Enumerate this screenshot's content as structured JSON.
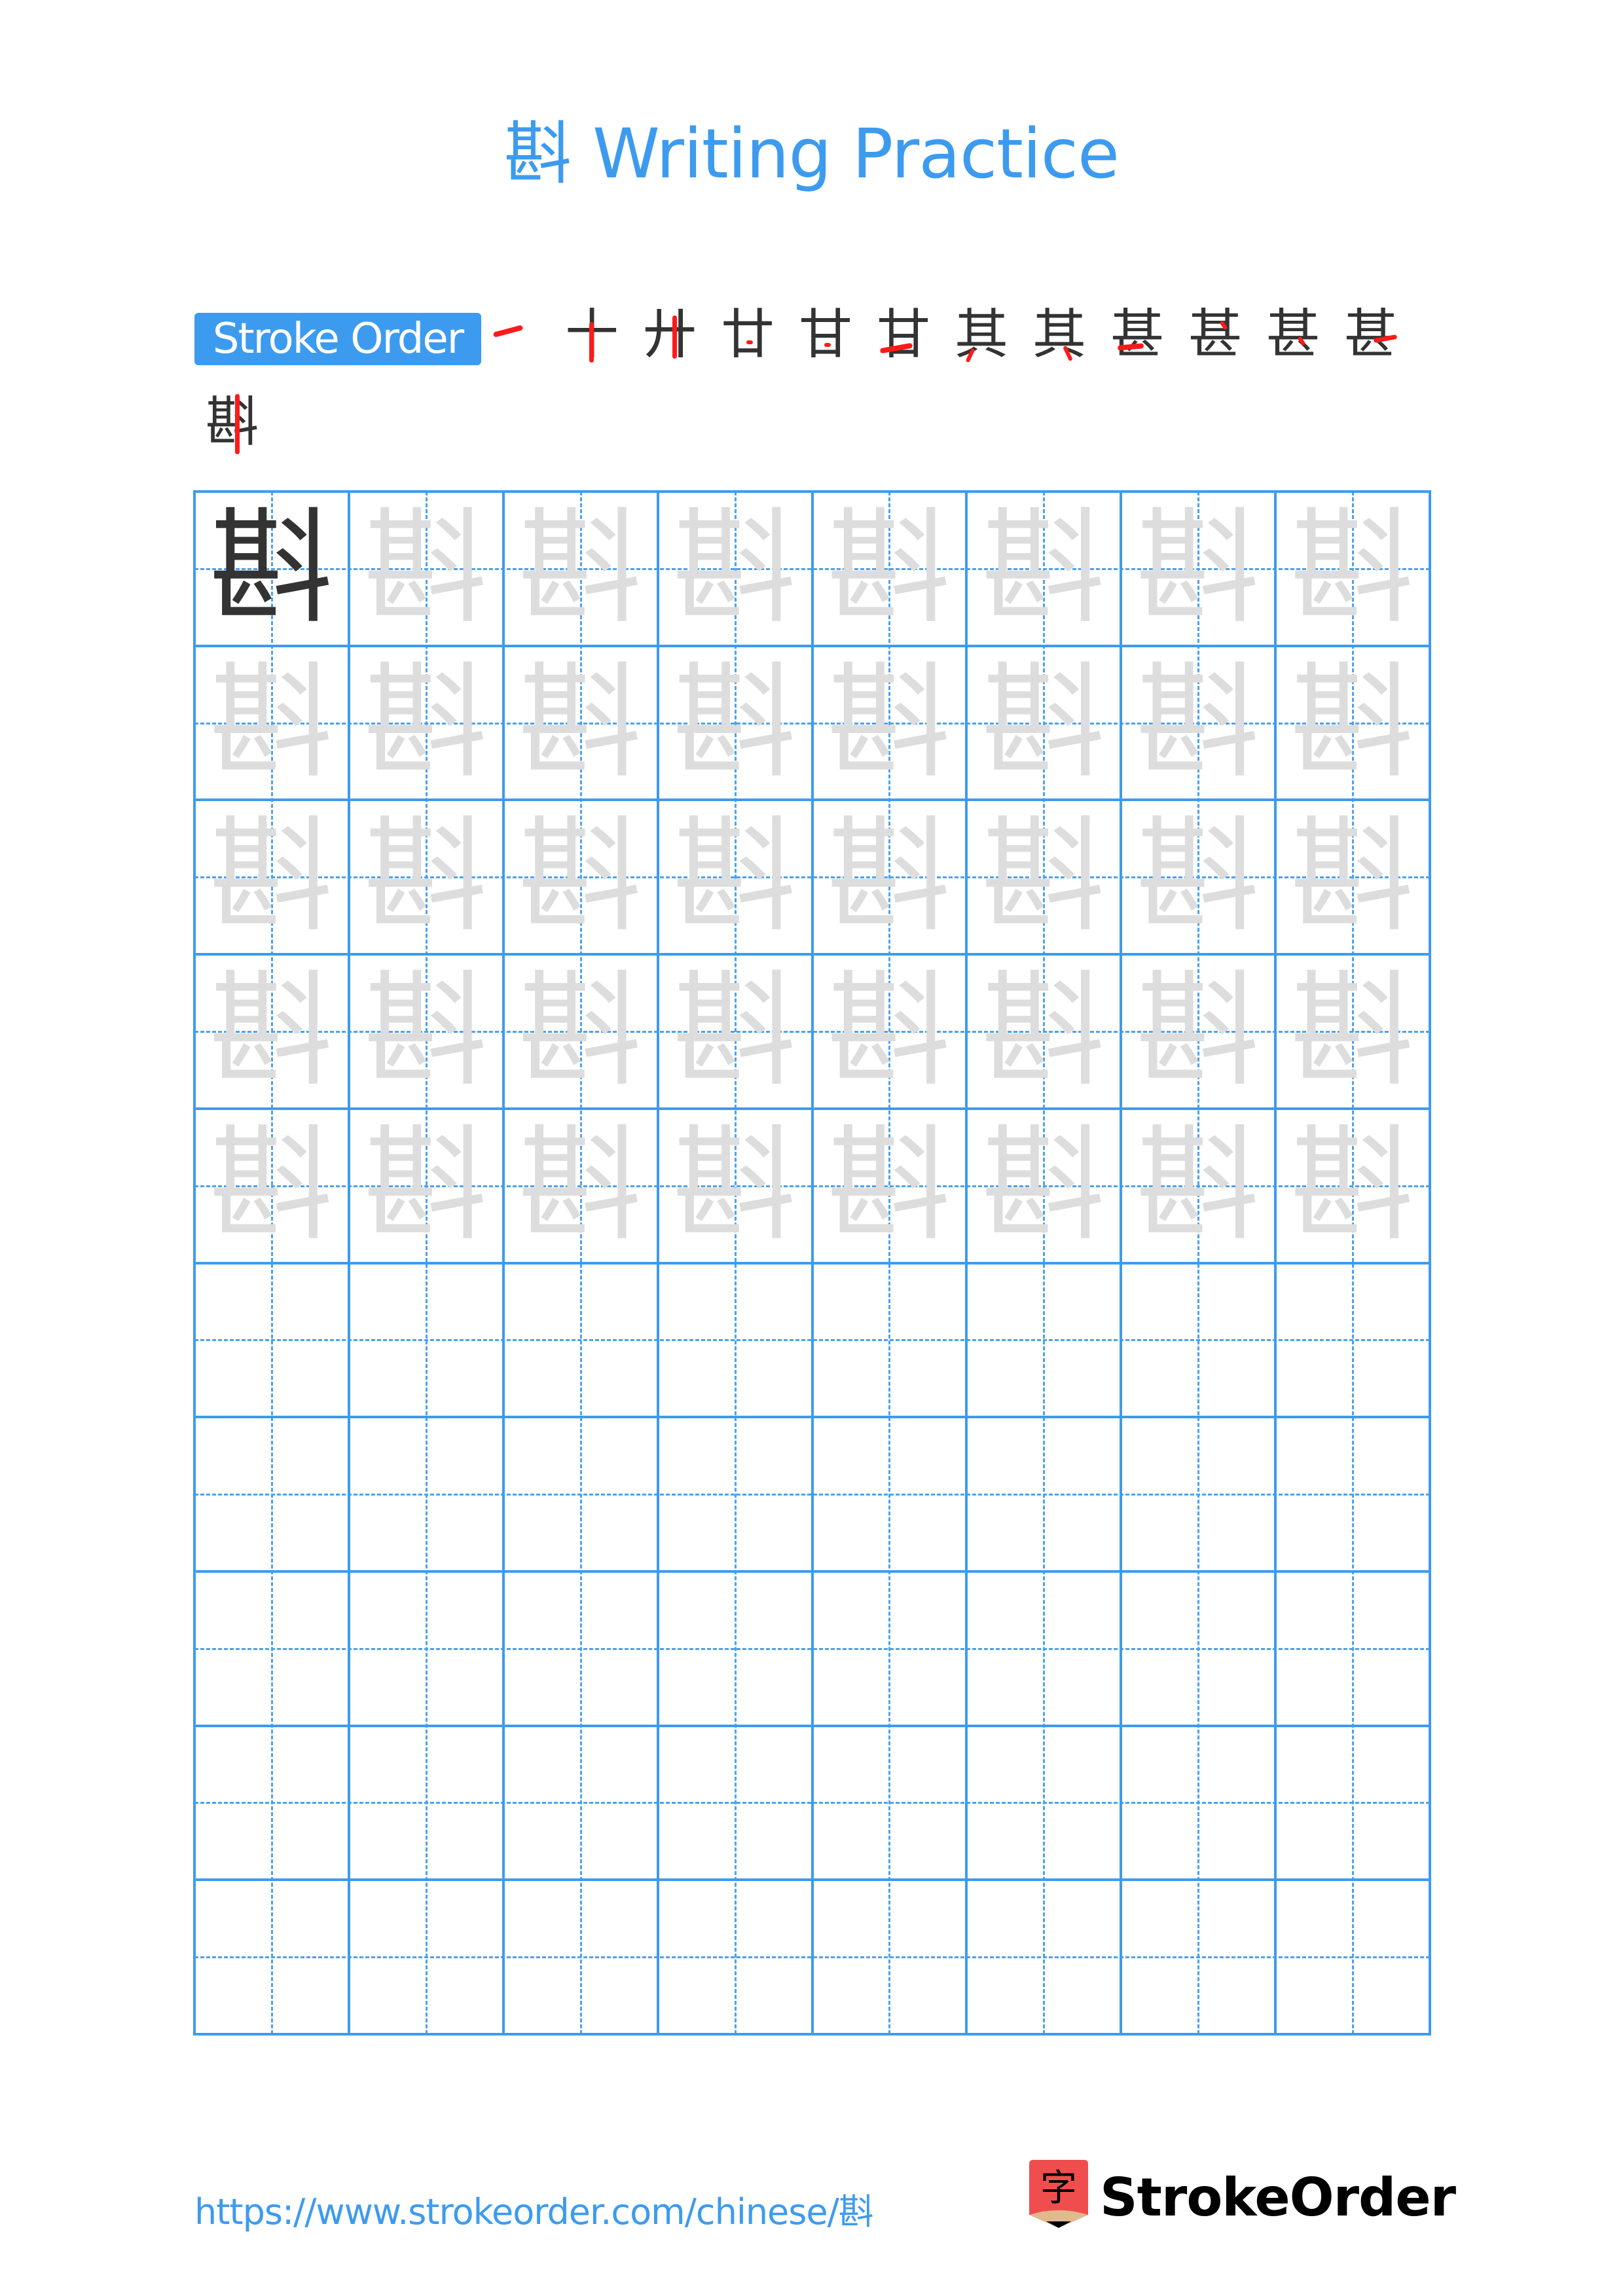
{
  "header": {
    "title": "斟 Writing Practice"
  },
  "stroke_order": {
    "label": "Stroke Order",
    "character": "斟",
    "stroke_count": 13,
    "steps": [
      {
        "glyph": "一",
        "step": 1
      },
      {
        "glyph": "十",
        "step": 2
      },
      {
        "glyph": "廾",
        "step": 3
      },
      {
        "glyph": "廿",
        "step": 4
      },
      {
        "glyph": "甘",
        "step": 5
      },
      {
        "glyph": "甘",
        "step": 6
      },
      {
        "glyph": "其",
        "step": 7
      },
      {
        "glyph": "其",
        "step": 8
      },
      {
        "glyph": "甚",
        "step": 9
      },
      {
        "glyph": "甚",
        "step": 10
      },
      {
        "glyph": "甚",
        "step": 11
      },
      {
        "glyph": "甚",
        "step": 12
      },
      {
        "glyph": "斟",
        "step": 13
      }
    ],
    "highlight_color": "#ff1a1a",
    "stroke_color": "#333333"
  },
  "practice_grid": {
    "character": "斟",
    "columns": 8,
    "rows": 10,
    "rows_with_characters": 5,
    "model_cells": 1,
    "grid_color": "#3d9bef",
    "model_color": "#333333",
    "trace_color": "#dddddd"
  },
  "footer": {
    "url": "https://www.strokeorder.com/chinese/斟",
    "logo_glyph": "字",
    "logo_text": "StrokeOrder"
  },
  "colors": {
    "accent": "#3d9bef",
    "logo_red": "#f04e4e",
    "logo_tan": "#e0b98e"
  }
}
